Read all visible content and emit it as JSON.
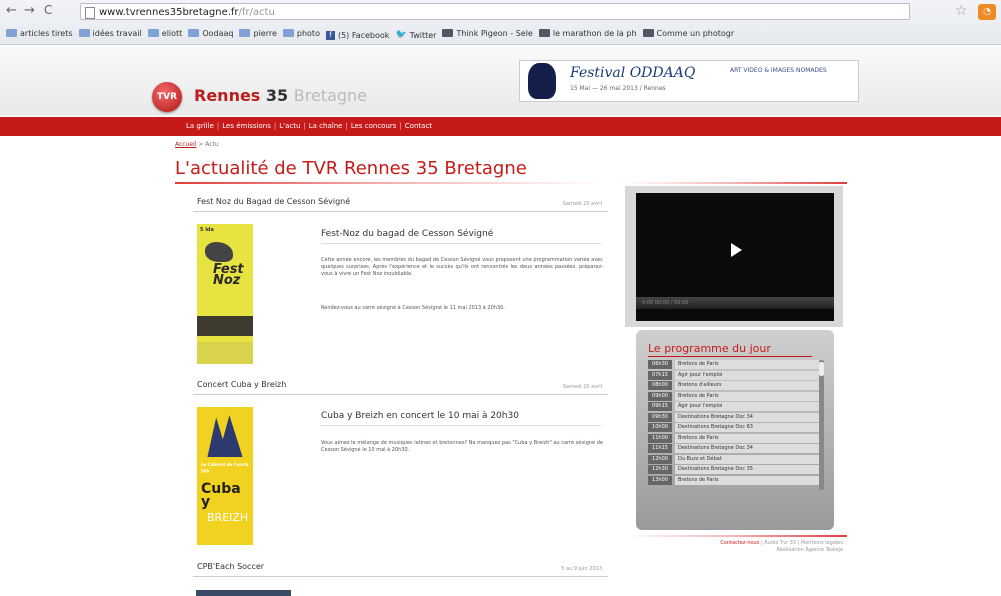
{
  "browser": {
    "url_main": "www.tvrennes35bretagne.fr",
    "url_rest": "/fr/actu",
    "bookmarks": [
      {
        "type": "folder",
        "label": "articles tirets"
      },
      {
        "type": "folder",
        "label": "idées travail"
      },
      {
        "type": "folder",
        "label": "eliott"
      },
      {
        "type": "folder",
        "label": "Oodaaq"
      },
      {
        "type": "folder",
        "label": "pierre"
      },
      {
        "type": "folder",
        "label": "photo"
      },
      {
        "type": "facebook",
        "label": "(5) Facebook"
      },
      {
        "type": "twitter",
        "label": "Twitter"
      },
      {
        "type": "link",
        "label": "Think Pigeon - Sele"
      },
      {
        "type": "link",
        "label": "le marathon de la ph"
      },
      {
        "type": "link",
        "label": "Comme un photogr"
      }
    ]
  },
  "site": {
    "logo_badge": "TVR",
    "logo_name": "Rennes",
    "logo_num": "35",
    "logo_region": "Bretagne",
    "banner": {
      "title": "Festival ODDAAQ",
      "subtitle": "15 Mai — 26 mai 2013 / Rennes",
      "right": "ART VIDEO & IMAGES NOMADES"
    },
    "nav": [
      "La grille",
      "Les émissions",
      "L'actu",
      "La chaîne",
      "Les concours",
      "Contact"
    ],
    "breadcrumb_home": "Accueil",
    "breadcrumb_current": "Actu",
    "page_title": "L'actualité de TVR Rennes 35 Bretagne"
  },
  "articles": [
    {
      "name": "Fest Noz du Bagad de Cesson Sévigné",
      "date": "Samedi 20 avril",
      "heading": "Fest-Noz du bagad de Cesson Sévigné",
      "text": "Cette année encore, les membres du bagad de Cesson Sévigné vous proposent une programmation variée avec quelques surprises. Après l'expérience et le succès qu'ils ont rencontrés les deux années passées, préparez-vous à vivre un Fest Noz inoubliable.",
      "text2": "Rendez-vous au carré sévigné à Cesson Sévigné le 11 mai 2013 à 20h30.",
      "poster_title": "Fest Noz"
    },
    {
      "name": "Concert Cuba y Breizh",
      "date": "Samedi 20 avril",
      "heading": "Cuba y Breizh en concert le 10 mai à 20h30",
      "text": "Vous aimez le mélange de musiques latines et bretonnes? Ne manquez pas \"Cuba y Breizh\" au carré sévigné de Cesson Sévigné le 10 mai à 20h30.",
      "poster_title": "Cuba y",
      "poster_sub": "BREIZH"
    },
    {
      "name": "CPB'Each Soccer",
      "date": "5 au 9 juin 2013"
    }
  ],
  "player": {
    "times": "0:00  00:00 / 00:00"
  },
  "programme": {
    "title": "Le programme du jour",
    "items": [
      {
        "time": "06h30",
        "name": "Bretons de Paris"
      },
      {
        "time": "07h15",
        "name": "Agir pour l'emploi"
      },
      {
        "time": "08h00",
        "name": "Bretons d'ailleurs"
      },
      {
        "time": "09h00",
        "name": "Bretons de Paris"
      },
      {
        "time": "09h15",
        "name": "Agir pour l'emploi"
      },
      {
        "time": "09h30",
        "name": "Destinations Bretagne Doc 34"
      },
      {
        "time": "10h00",
        "name": "Destinations Bretagne Doc 63"
      },
      {
        "time": "11h00",
        "name": "Bretons de Paris"
      },
      {
        "time": "11h15",
        "name": "Destinations Bretagne Doc 34"
      },
      {
        "time": "12h00",
        "name": "Du Buzz et Débat"
      },
      {
        "time": "12h30",
        "name": "Destinations Bretagne Doc 35"
      },
      {
        "time": "13h00",
        "name": "Bretons de Paris"
      }
    ]
  },
  "footer": {
    "line1_red": "Contactez-nous",
    "line1": "| Audio Tvr 35 | Mentions légales",
    "line2": "Réalisation Agence Tealeja"
  }
}
